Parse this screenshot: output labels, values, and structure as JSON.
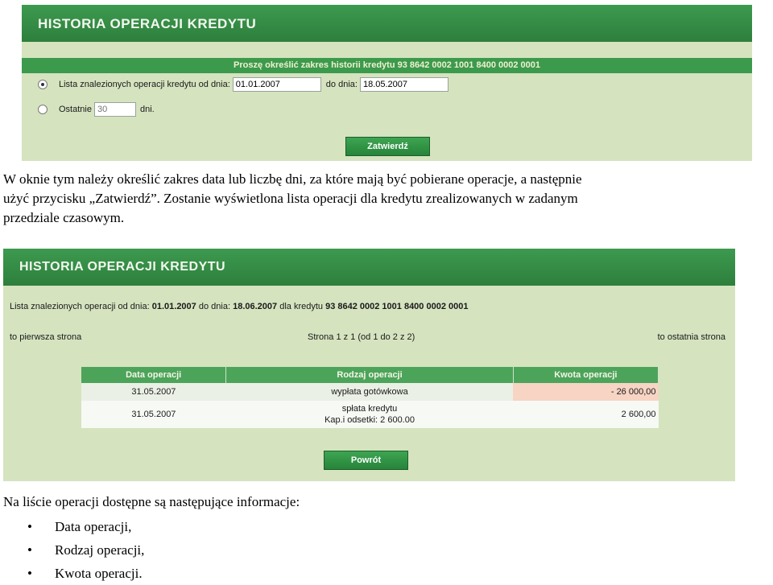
{
  "screen1": {
    "title": "HISTORIA OPERACJI KREDYTU",
    "form_header": "Proszę określić zakres historii kredytu  93 8642 0002 1001 8400 0002 0001",
    "option_range_label": "Lista znalezionych operacji kredytu od dnia:",
    "date_from": "01.01.2007",
    "to_label": "do dnia:",
    "date_to": "18.05.2007",
    "option_last_label": "Ostatnie",
    "last_days_placeholder": "30",
    "days_label": "dni.",
    "submit_label": "Zatwierdź",
    "selected_option": "range"
  },
  "text1": {
    "line1": "W oknie tym należy określić zakres data lub liczbę dni, za które mają być pobierane operacje, a następnie",
    "line2": "użyć przycisku „Zatwierdź”. Zostanie wyświetlona lista operacji dla kredytu zrealizowanych w zadanym",
    "line3": "przedziale czasowym."
  },
  "screen2": {
    "title": "HISTORIA OPERACJI KREDYTU",
    "summary_prefix": "Lista znalezionych operacji od dnia:",
    "summary_from": "01.01.2007",
    "summary_to_label": "do dnia:",
    "summary_to": "18.06.2007",
    "summary_loan_label": "dla kredytu",
    "summary_loan_number": "93 8642 0002 1001 8400 0002 0001",
    "first_page_link": "to pierwsza strona",
    "pagination": "Strona 1 z 1 (od 1 do 2 z 2)",
    "last_page_link": "to ostatnia strona",
    "columns": [
      "Data operacji",
      "Rodzaj operacji",
      "Kwota operacji"
    ],
    "rows": [
      {
        "date": "31.05.2007",
        "type_line1": "wypłata gotówkowa",
        "type_line2": "",
        "amount": "- 26 000,00"
      },
      {
        "date": "31.05.2007",
        "type_line1": "spłata kredytu",
        "type_line2": "Kap.i odsetki: 2 600.00",
        "amount": "2 600,00"
      }
    ],
    "back_label": "Powrót"
  },
  "text2": {
    "intro": "Na liście operacji dostępne są następujące informacje:",
    "items": [
      "Data operacji,",
      "Rodzaj operacji,",
      "Kwota operacji."
    ]
  },
  "colors": {
    "header_green": "#2d7f3c",
    "panel_bg": "#d5e3bf",
    "negative_amount_bg": "#f7d4c4"
  }
}
